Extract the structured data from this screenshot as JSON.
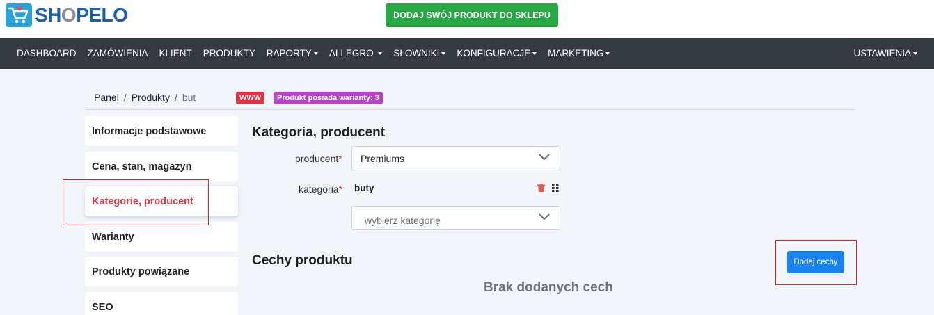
{
  "header": {
    "logo_prefix": "SH",
    "logo_o": "O",
    "logo_suffix": "PELO",
    "cta_label": "DODAJ SWÓJ PRODUKT DO SKLEPU"
  },
  "nav": {
    "items": [
      {
        "label": "DASHBOARD"
      },
      {
        "label": "ZAMÓWIENIA"
      },
      {
        "label": "KLIENT"
      },
      {
        "label": "PRODUKTY"
      },
      {
        "label": "RAPORTY"
      },
      {
        "label": "ALLEGRO"
      },
      {
        "label": "SŁOWNIKI"
      },
      {
        "label": "KONFIGURACJE"
      },
      {
        "label": "MARKETING"
      }
    ],
    "right": "USTAWIENIA"
  },
  "breadcrumb": [
    "Panel",
    "Produkty",
    "but"
  ],
  "breadcrumb_sep": "/",
  "badges": {
    "www": "WWW",
    "variants": "Produkt posiada warianty: 3"
  },
  "side_menu": [
    {
      "label": "Informacje podstawowe"
    },
    {
      "label": "Cena, stan, magazyn"
    },
    {
      "label": "Kategorie, producent"
    },
    {
      "label": "Warianty"
    },
    {
      "label": "Produkty powiązane"
    },
    {
      "label": "SEO"
    }
  ],
  "section1": {
    "title": "Kategoria, producent",
    "producer_label": "producent",
    "producer_value": "Premiums",
    "category_label": "kategoria",
    "category_value": "buty",
    "category_placeholder": "wybierz kategorię",
    "required_mark": "*"
  },
  "section2": {
    "title": "Cechy produktu",
    "add_button": "Dodaj cechy",
    "empty_text": "Brak dodanych cech"
  },
  "colors": {
    "brand_blue": "#1c5fa8",
    "cta_green": "#28a745",
    "nav_dark": "#343a40",
    "danger": "#dc3545",
    "variant_purple": "#b845c6",
    "primary": "#1a82f0",
    "highlight_red": "#e02424"
  }
}
